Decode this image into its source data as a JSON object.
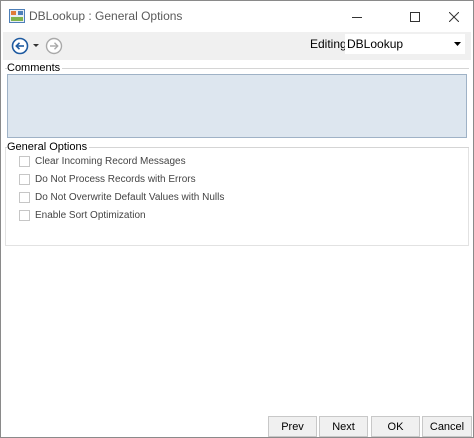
{
  "window": {
    "title": "DBLookup : General Options"
  },
  "toolbar": {
    "editing_label": "Editing:",
    "editing_value": "DBLookup",
    "back_icon": "back-arrow-icon",
    "forward_icon": "forward-arrow-icon"
  },
  "comments": {
    "label": "Comments",
    "value": ""
  },
  "general_options": {
    "label": "General Options",
    "items": [
      {
        "label": "Clear Incoming Record Messages",
        "checked": false
      },
      {
        "label": "Do Not Process Records with Errors",
        "checked": false
      },
      {
        "label": "Do Not Overwrite Default Values with Nulls",
        "checked": false
      },
      {
        "label": "Enable Sort Optimization",
        "checked": false
      }
    ]
  },
  "buttons": {
    "prev": "Prev",
    "next": "Next",
    "ok": "OK",
    "cancel": "Cancel"
  },
  "colors": {
    "comments_bg": "#dde6ef",
    "toolbar_bg": "#f0f0f0",
    "nav_blue": "#1e5aa0"
  }
}
